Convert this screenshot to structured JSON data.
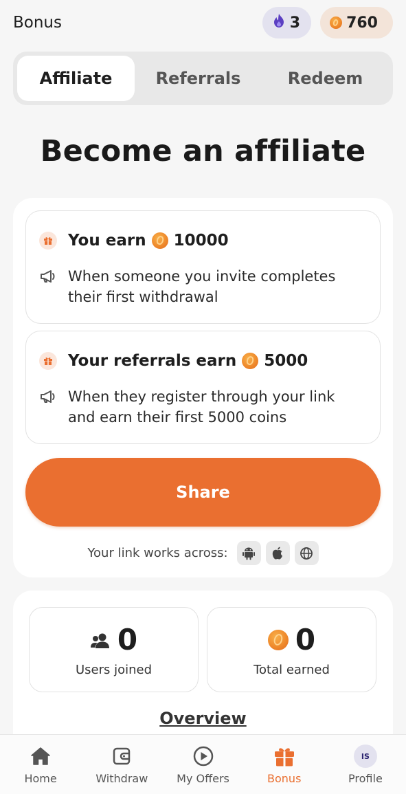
{
  "header": {
    "title": "Bonus",
    "streak_count": "3",
    "coin_balance": "760"
  },
  "tabs": [
    {
      "label": "Affiliate",
      "active": true
    },
    {
      "label": "Referrals",
      "active": false
    },
    {
      "label": "Redeem",
      "active": false
    }
  ],
  "headline": "Become an affiliate",
  "cards": [
    {
      "title_prefix": "You earn",
      "amount": "10000",
      "description": "When someone you invite completes their first withdrawal"
    },
    {
      "title_prefix": "Your referrals earn",
      "amount": "5000",
      "description": "When they register through your link and earn their first 5000 coins"
    }
  ],
  "share_label": "Share",
  "platforms_label": "Your link works across:",
  "platform_icons": [
    "android-icon",
    "apple-icon",
    "globe-icon"
  ],
  "stats": [
    {
      "value": "0",
      "label": "Users joined",
      "icon": "users-icon"
    },
    {
      "value": "0",
      "label": "Total earned",
      "icon": "coin-icon"
    }
  ],
  "overview_label": "Overview",
  "nav": [
    {
      "label": "Home",
      "icon": "home-icon",
      "active": false
    },
    {
      "label": "Withdraw",
      "icon": "wallet-icon",
      "active": false
    },
    {
      "label": "My Offers",
      "icon": "play-icon",
      "active": false
    },
    {
      "label": "Bonus",
      "icon": "gift-icon",
      "active": true
    },
    {
      "label": "Profile",
      "icon": "avatar",
      "active": false,
      "initials": "IS"
    }
  ],
  "colors": {
    "accent": "#ea6f30",
    "background": "#f6f6f6",
    "streak_pill": "#e3e2ef",
    "coin_pill": "#f3e4d9"
  }
}
